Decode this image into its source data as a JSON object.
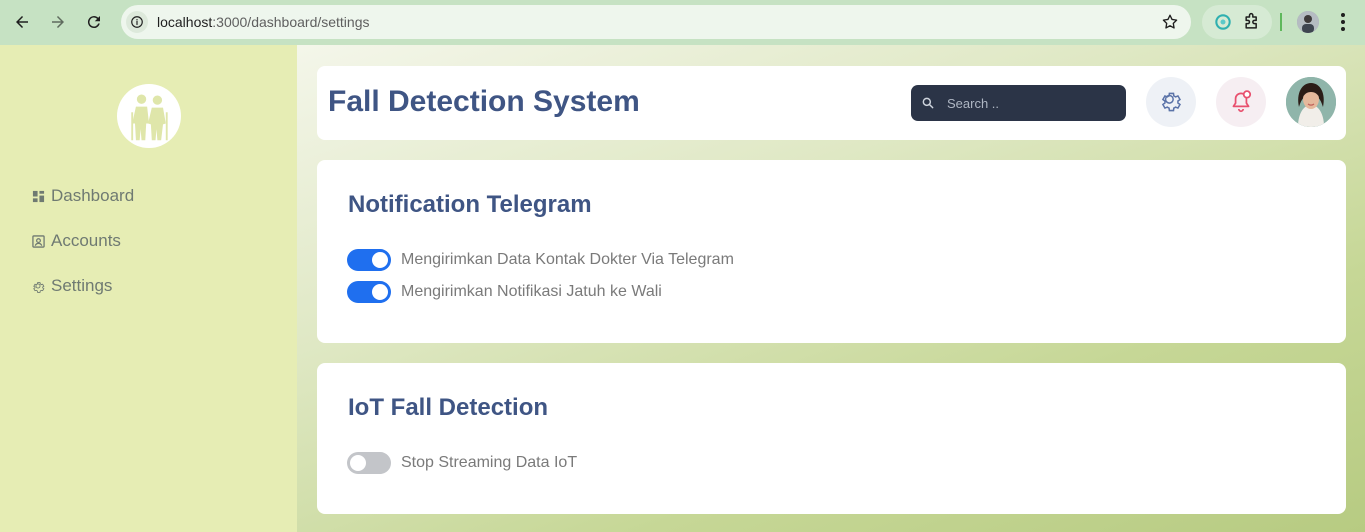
{
  "browser": {
    "url_host": "localhost",
    "url_path": ":3000/dashboard/settings"
  },
  "sidebar": {
    "logo_icon": "elderly-couple-icon",
    "items": [
      {
        "label": "Dashboard",
        "icon": "dashboard-grid-icon"
      },
      {
        "label": "Accounts",
        "icon": "account-icon"
      },
      {
        "label": "Settings",
        "icon": "gear-icon"
      }
    ]
  },
  "header": {
    "title": "Fall Detection System",
    "search_placeholder": "Search .."
  },
  "notification_card": {
    "title": "Notification Telegram",
    "toggles": [
      {
        "label": "Mengirimkan Data Kontak Dokter Via Telegram",
        "checked": true
      },
      {
        "label": "Mengirimkan Notifikasi Jatuh ke Wali",
        "checked": true
      }
    ]
  },
  "iot_card": {
    "title": "IoT Fall Detection",
    "toggles": [
      {
        "label": "Stop Streaming Data IoT",
        "checked": false
      }
    ]
  },
  "colors": {
    "sidebar_bg": "#e6edb4",
    "title_color": "#3f5584",
    "toggle_on": "#1f6fef",
    "toggle_off": "#c3c5c9",
    "search_bg": "#2b3447"
  }
}
